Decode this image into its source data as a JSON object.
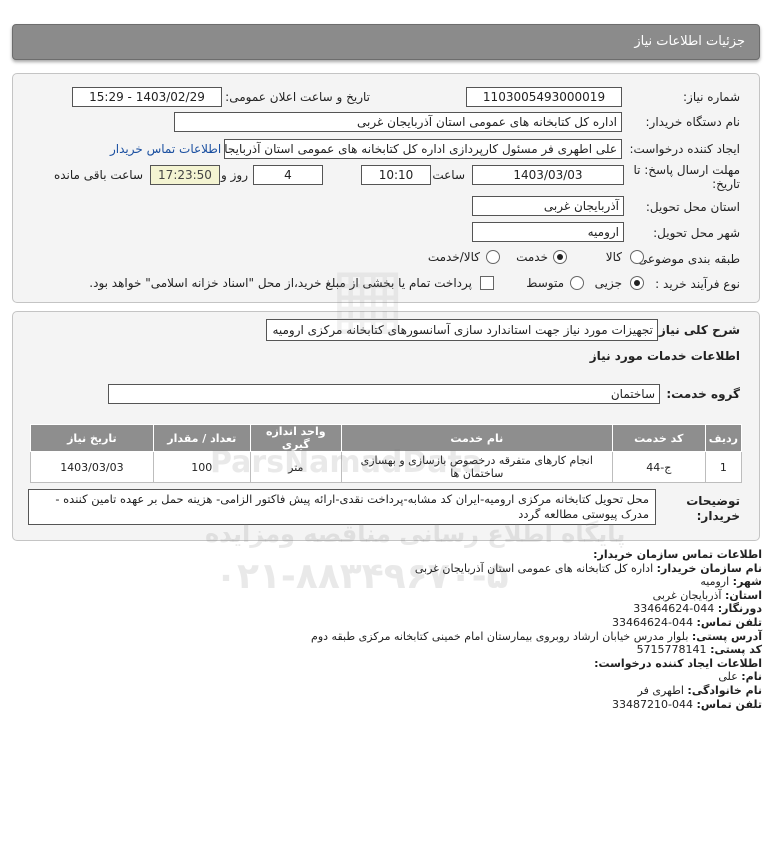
{
  "page_title": "جزئیات اطلاعات نیاز",
  "form": {
    "need_number_label": "شماره نیاز:",
    "need_number": "1103005493000019",
    "announce_label": "تاریخ و ساعت اعلان عمومی:",
    "announce_value": "1403/02/29 - 15:29",
    "buyer_org_label": "نام دستگاه خریدار:",
    "buyer_org": "اداره کل کتابخانه های عمومی استان آذربایجان غربی",
    "creator_label": "ایجاد کننده درخواست:",
    "creator": "علی اطهری فر مسئول کارپردازی اداره کل کتابخانه های عمومی استان آذربایجان",
    "contact_link": "اطلاعات تماس خریدار",
    "deadline_label_1": "مهلت ارسال پاسخ: تا",
    "deadline_label_2": "تاریخ:",
    "deadline_date": "1403/03/03",
    "time_label": "ساعت",
    "deadline_time": "10:10",
    "days_value": "4",
    "days_label": "روز و",
    "remaining_time": "17:23:50",
    "remaining_label": "ساعت باقی مانده",
    "province_label": "استان محل تحویل:",
    "province": "آذربایجان غربی",
    "city_label": "شهر محل تحویل:",
    "city": "ارومیه",
    "category_label": "طبقه بندی موضوعی:",
    "category_options": [
      "کالا",
      "خدمت",
      "کالا/خدمت"
    ],
    "category_selected": "خدمت",
    "process_label": "نوع فرآیند خرید :",
    "process_options": [
      "جزیی",
      "متوسط"
    ],
    "process_selected": "جزیی",
    "treasury_text": "پرداخت تمام یا بخشی از مبلغ خرید،از محل \"اسناد خزانه اسلامی\" خواهد بود."
  },
  "details": {
    "summary_label": "شرح کلی نیاز:",
    "summary": "تجهیزات مورد نیاز جهت استاندارد سازی آسانسورهای کتابخانه مرکزی ارومیه",
    "services_title": "اطلاعات خدمات مورد نیاز",
    "service_group_label": "گروه خدمت:",
    "service_group": "ساختمان",
    "table": {
      "headers": [
        "ردیف",
        "کد خدمت",
        "نام خدمت",
        "واحد اندازه گیری",
        "تعداد / مقدار",
        "تاریخ نیاز"
      ],
      "rows": [
        [
          "1",
          "ج-44",
          "انجام کارهای متفرقه درخصوص بازسازی و بهسازی ساختمان ها",
          "متر",
          "100",
          "1403/03/03"
        ]
      ]
    },
    "buyer_notes_label_1": "توضیحات",
    "buyer_notes_label_2": "خریدار:",
    "buyer_notes": "محل تحویل کتابخانه مرکزی ارومیه-ایران کد مشابه-پرداخت نقدی-ارائه پیش فاکتور الزامی- هزینه حمل بر عهده تامین کننده - مدرک پیوستی مطالعه گردد"
  },
  "watermark": {
    "line1": "پایگاه اطلاع رسانی مناقصه ومزایده",
    "phone": "۰۲۱-۸۸۳۴۹۶۷۰-۵",
    "brand": "ParsNamadData"
  },
  "contact": {
    "buyer_title": "اطلاعات تماس سازمان خریدار:",
    "org_name_label": "نام سازمان خریدار:",
    "org_name": "اداره کل کتابخانه های عمومی استان آذربایجان غربی",
    "city_label": "شهر:",
    "city": "ارومیه",
    "province_label": "استان:",
    "province": "آذربایجان غربی",
    "fax_label": "دورنگار:",
    "fax": "044-33464624",
    "phone_label": "تلفن تماس:",
    "phone": "044-33464624",
    "address_label": "آدرس پستی:",
    "address": "بلوار مدرس خیابان ارشاد روبروی بیمارستان امام خمینی کتابخانه مرکزی طبقه دوم",
    "postal_label": "کد پستی:",
    "postal": "5715778141",
    "creator_title": "اطلاعات ایجاد کننده درخواست:",
    "first_name_label": "نام:",
    "first_name": "علی",
    "last_name_label": "نام خانوادگی:",
    "last_name": "اطهری فر",
    "creator_phone_label": "تلفن تماس:",
    "creator_phone": "044-33487210"
  }
}
